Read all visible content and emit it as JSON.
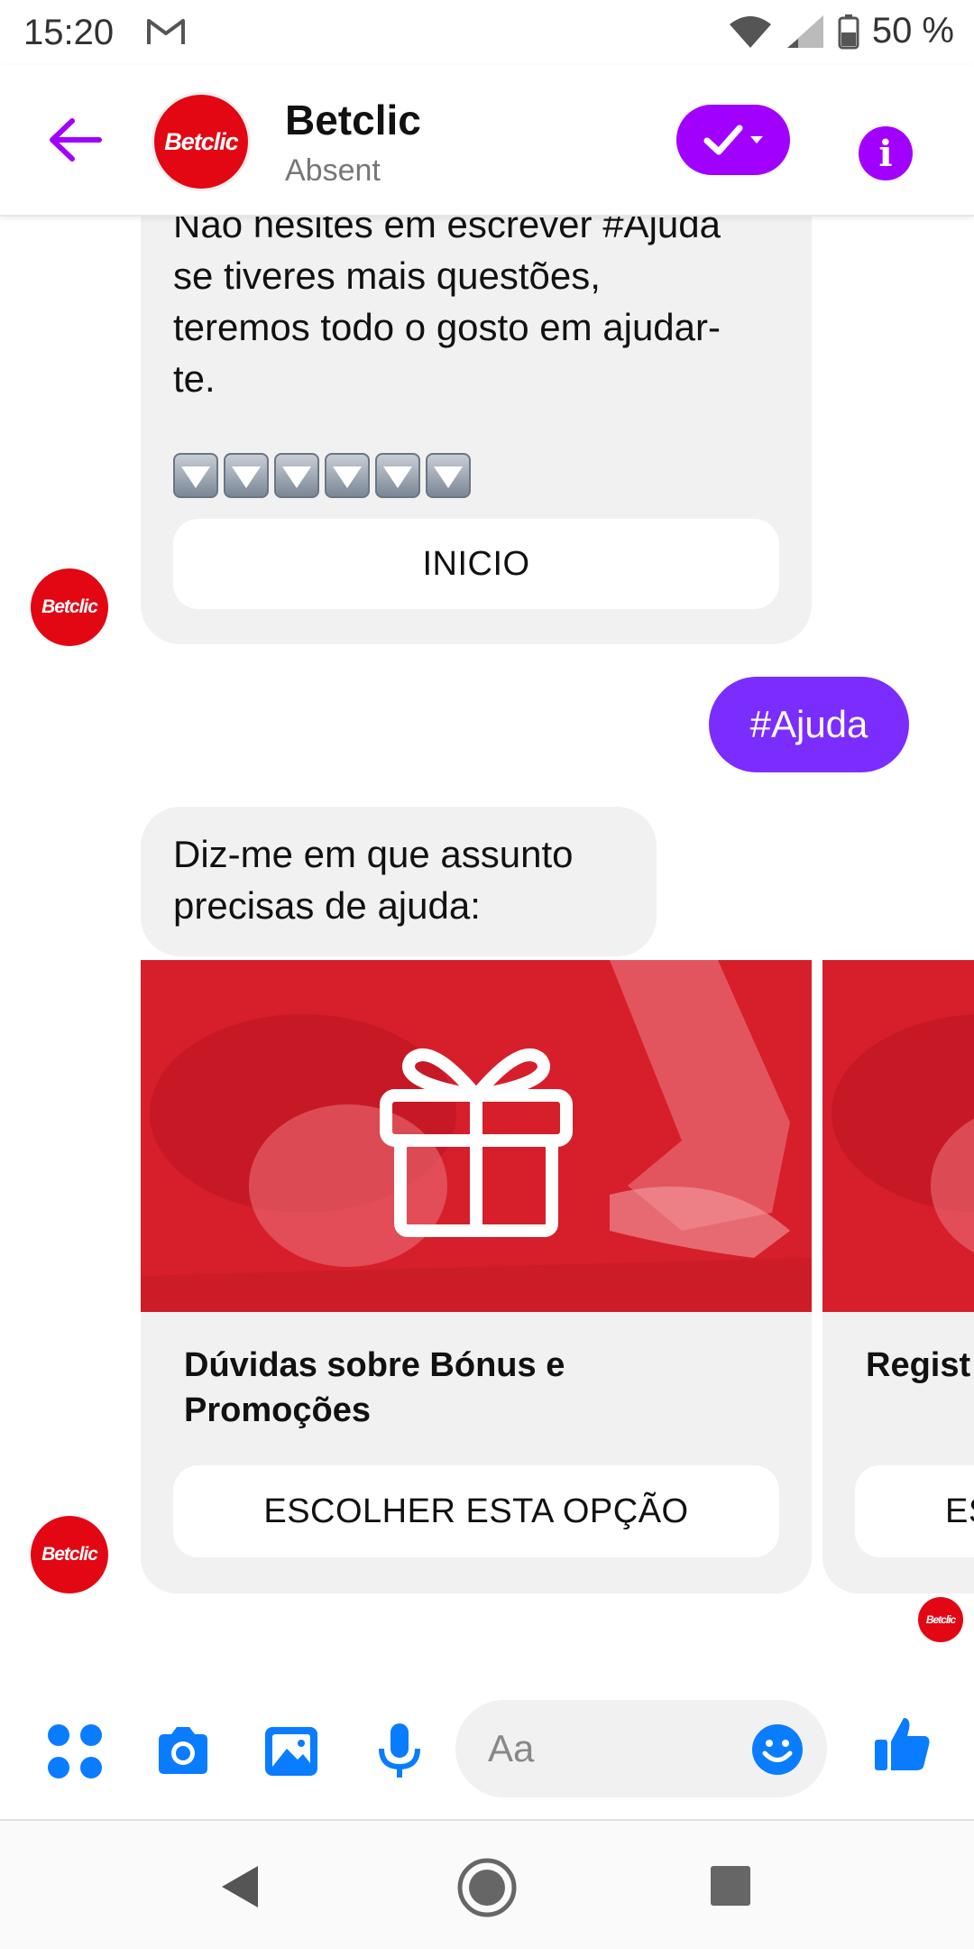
{
  "status_bar": {
    "time": "15:20",
    "battery": "50 %"
  },
  "header": {
    "contact_name": "Betclic",
    "contact_status": "Absent",
    "logo_text": "Betclic"
  },
  "messages": {
    "bot_msg_1_text": "Não hesites em escrever #Ajuda se tiveres mais questões, teremos todo o gosto em ajudar-te.",
    "bot_msg_1_button": "INICIO",
    "user_msg": "#Ajuda",
    "bot_msg_2_text": "Diz-me em que assunto precisas de ajuda:"
  },
  "carousel": {
    "cards": [
      {
        "title": "Dúvidas sobre Bónus e Promoções",
        "button": "ESCOLHER ESTA OPÇÃO"
      },
      {
        "title": "Regist",
        "button": "ES"
      }
    ]
  },
  "composer": {
    "placeholder": "Aa"
  },
  "icons": {
    "back": "arrow-left-icon",
    "done": "check-dropdown-icon",
    "info": "info-icon",
    "apps": "apps-icon",
    "camera": "camera-icon",
    "gallery": "image-icon",
    "mic": "microphone-icon",
    "emoji": "emoji-icon",
    "like": "thumbs-up-icon"
  },
  "colors": {
    "accent": "#a100ff",
    "user_bubble": "#7b2cff",
    "brand_red": "#e30613",
    "composer_blue": "#0a7cff"
  }
}
